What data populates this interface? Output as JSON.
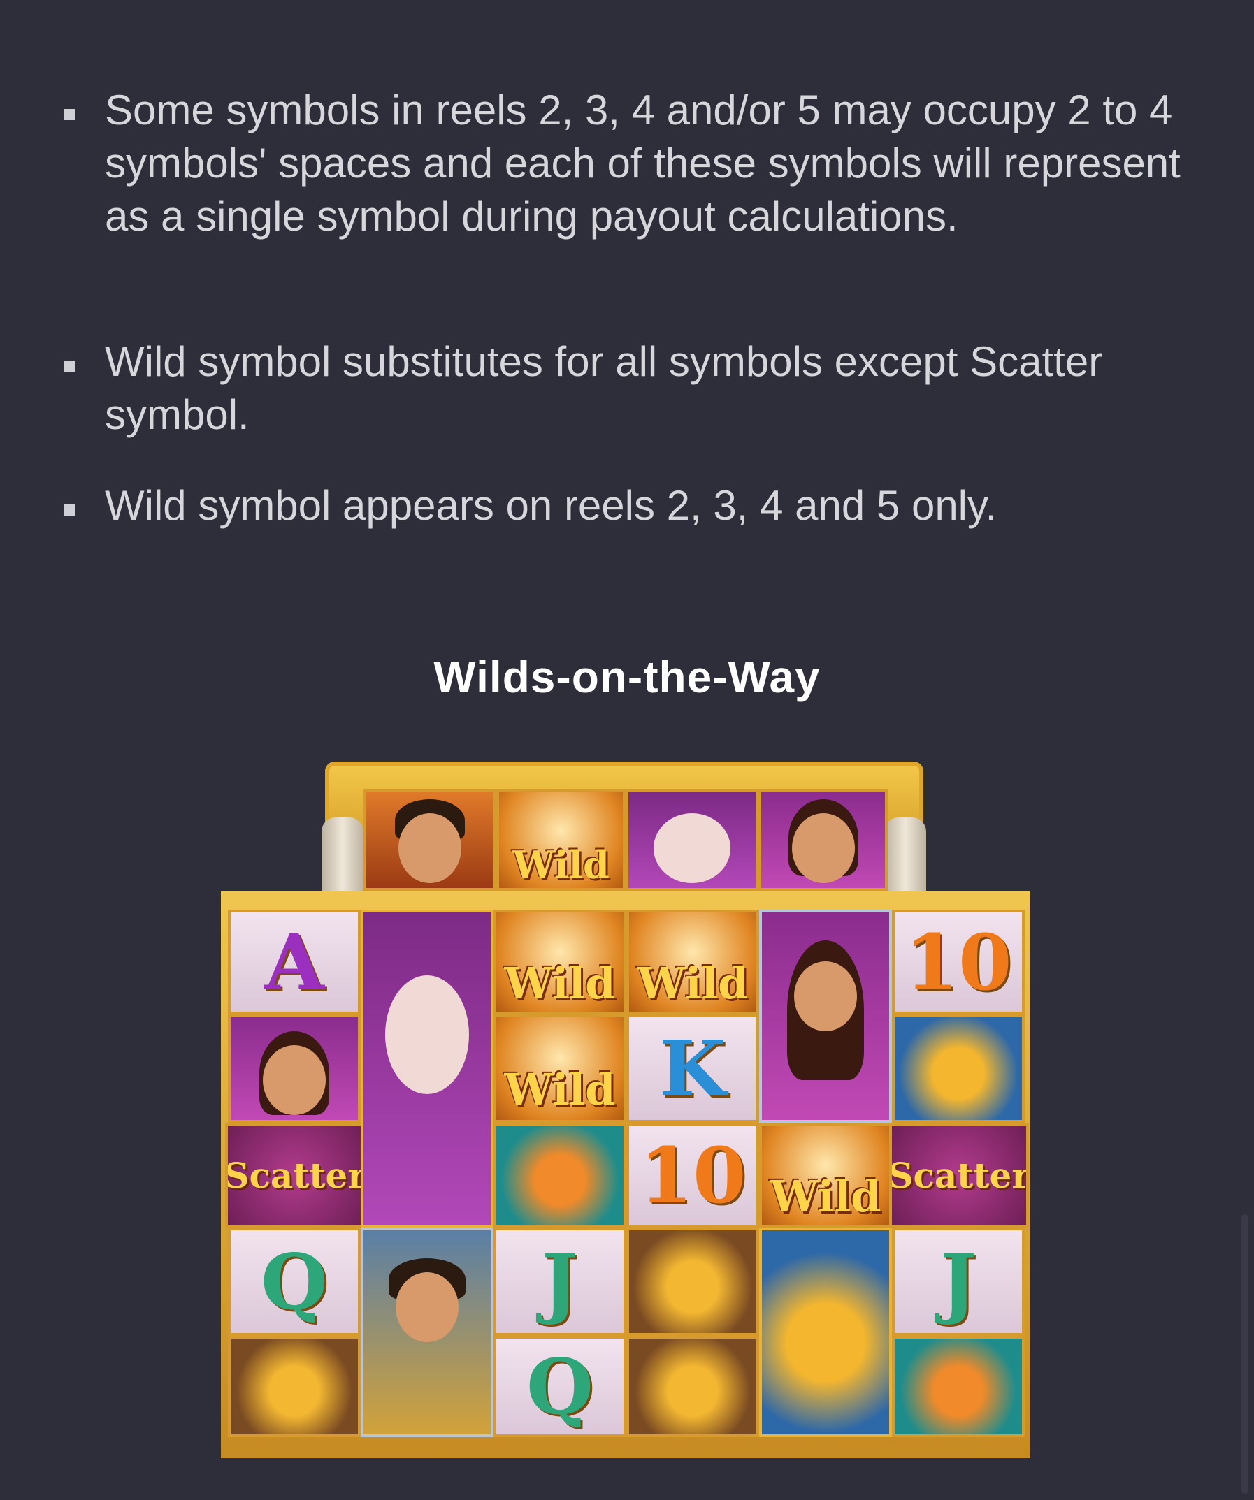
{
  "rules": [
    "Some symbols in reels 2, 3, 4 and/or 5 may occupy 2 to 4 symbols' spaces and each of these symbols will represent as a single symbol during payout calculations.",
    "Wild symbol substitutes for all symbols except Scatter symbol.",
    "Wild symbol appears on reels 2, 3, 4 and 5 only."
  ],
  "section_title": "Wilds-on-the-Way",
  "symbols": {
    "wild": "Wild",
    "scatter": "Scatter",
    "A": "A",
    "K": "K",
    "Q": "Q",
    "J": "J",
    "ten": "10"
  }
}
